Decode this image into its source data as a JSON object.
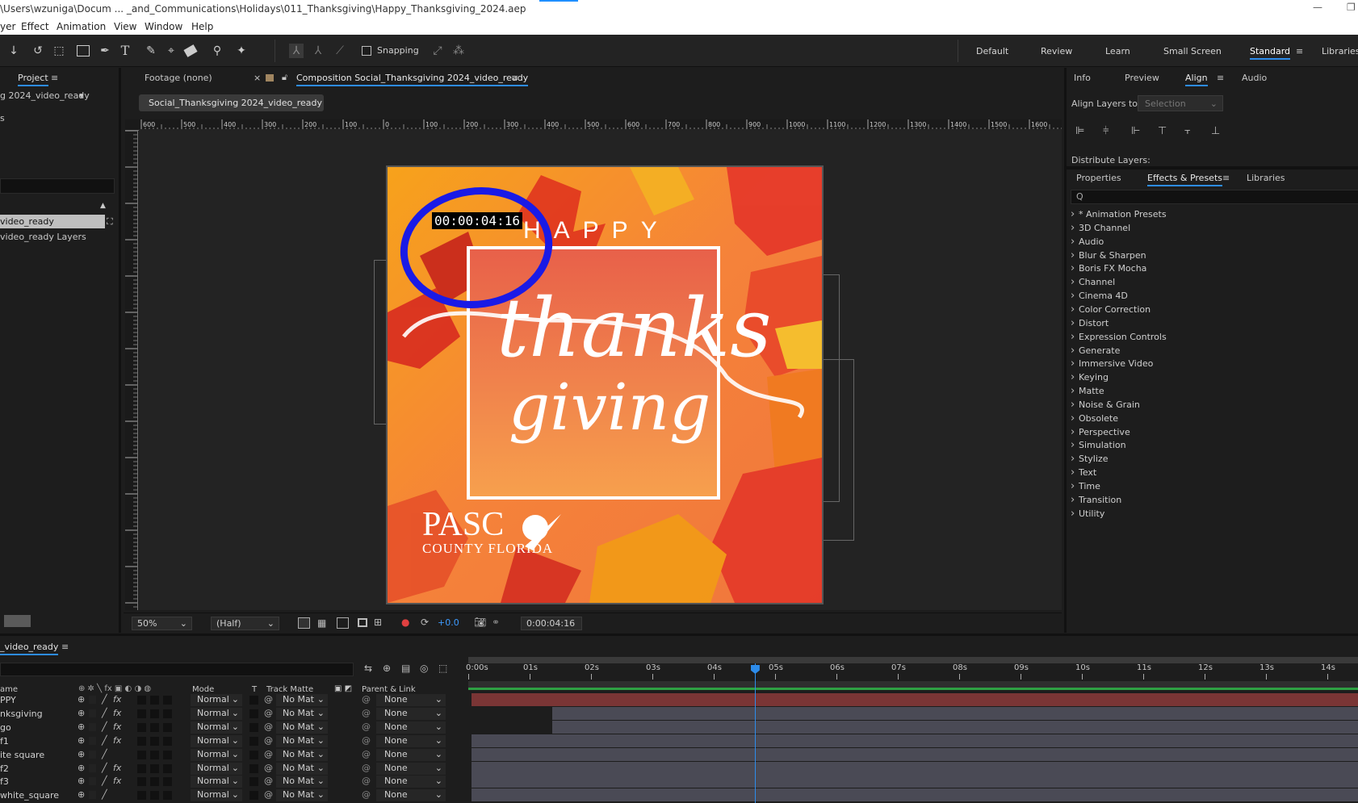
{
  "window": {
    "title": "\\Users\\wzuniga\\Docum ... _and_Communications\\Holidays\\011_Thanksgiving\\Happy_Thanksgiving_2024.aep",
    "minimize_glyph": "—",
    "restore_glyph": "❐"
  },
  "menu": [
    "yer",
    "Effect",
    "Animation",
    "View",
    "Window",
    "Help"
  ],
  "toolbar": {
    "snapping_label": "Snapping",
    "workspaces": [
      "Default",
      "Review",
      "Learn",
      "Small Screen",
      "Standard",
      "Libraries"
    ],
    "active_workspace": "Standard",
    "text_tool_glyph": "T",
    "tool_glyphs": [
      "↓",
      "↺",
      "⬚",
      "✒",
      "✎",
      "⌖",
      "⚲",
      "✦",
      "⤢",
      "⁂"
    ]
  },
  "project": {
    "tab_label": "Project",
    "comp_dropdown": "g 2024_video_ready",
    "small_label": "s",
    "items": [
      "video_ready",
      "video_ready Layers"
    ]
  },
  "viewer": {
    "footage_tab": "Footage (none)",
    "comp_tab": "Composition Social_Thanksgiving 2024_video_ready",
    "comp_chip": "Social_Thanksgiving 2024_video_ready",
    "close_glyph": "×",
    "ruler_ticks": [
      "600",
      "500",
      "400",
      "300",
      "200",
      "100",
      "0",
      "100",
      "200",
      "300",
      "400",
      "500",
      "600",
      "700",
      "800",
      "900",
      "1000",
      "1100",
      "1200",
      "1300",
      "1400",
      "1500",
      "1600"
    ],
    "artwork": {
      "timecode_overlay": "00:00:04:16",
      "happy": "HAPPY",
      "thanks": "thanks",
      "giving": "giving",
      "logo_main": "PASC",
      "logo_sub": "COUNTY FLORIDA"
    },
    "bottom_bar": {
      "zoom": "50%",
      "resolution": "(Half)",
      "exposure": "+0.0",
      "timecode": "0:00:04:16"
    }
  },
  "right_panel": {
    "tabs_top": [
      "Info",
      "Preview",
      "Align",
      "Audio"
    ],
    "active_top": "Align",
    "align_layers_to_label": "Align Layers to:",
    "align_select": "Selection",
    "distribute_label": "Distribute Layers:",
    "tabs_bottom": [
      "Properties",
      "Effects & Presets",
      "Libraries"
    ],
    "active_bottom": "Effects & Presets",
    "search_placeholder": "",
    "search_glyph": "Q",
    "effects": [
      "* Animation Presets",
      "3D Channel",
      "Audio",
      "Blur & Sharpen",
      "Boris FX Mocha",
      "Channel",
      "Cinema 4D",
      "Color Correction",
      "Distort",
      "Expression Controls",
      "Generate",
      "Immersive Video",
      "Keying",
      "Matte",
      "Noise & Grain",
      "Obsolete",
      "Perspective",
      "Simulation",
      "Stylize",
      "Text",
      "Time",
      "Transition",
      "Utility"
    ]
  },
  "timeline": {
    "comp_name": "_video_ready",
    "columns": {
      "name": "ame",
      "mode": "Mode",
      "t": "T",
      "track_matte": "Track Matte",
      "parent": "Parent & Link"
    },
    "layers": [
      {
        "name": "PPY",
        "mode": "Normal",
        "matte": "No Mat",
        "parent": "None",
        "fx": true
      },
      {
        "name": "nksgiving",
        "mode": "Normal",
        "matte": "No Mat",
        "parent": "None",
        "fx": true
      },
      {
        "name": "go",
        "mode": "Normal",
        "matte": "No Mat",
        "parent": "None",
        "fx": true
      },
      {
        "name": "f1",
        "mode": "Normal",
        "matte": "No Mat",
        "parent": "None",
        "fx": true
      },
      {
        "name": "ite square",
        "mode": "Normal",
        "matte": "No Mat",
        "parent": "None",
        "fx": false
      },
      {
        "name": "f2",
        "mode": "Normal",
        "matte": "No Mat",
        "parent": "None",
        "fx": true
      },
      {
        "name": "f3",
        "mode": "Normal",
        "matte": "No Mat",
        "parent": "None",
        "fx": true
      },
      {
        "name": "white_square",
        "mode": "Normal",
        "matte": "No Mat",
        "parent": "None",
        "fx": false
      }
    ],
    "ruler": [
      "0:00s",
      "01s",
      "02s",
      "03s",
      "04s",
      "05s",
      "06s",
      "07s",
      "08s",
      "09s",
      "10s",
      "11s",
      "12s",
      "13s",
      "14s"
    ],
    "playhead_seconds": 4.67
  },
  "colors": {
    "accent": "#2d8ceb",
    "layer_red": "#7a3535",
    "layer_gray": "#4a4a55",
    "work_area_green": "#2ea043",
    "annotation_blue": "#1a1ae6"
  }
}
